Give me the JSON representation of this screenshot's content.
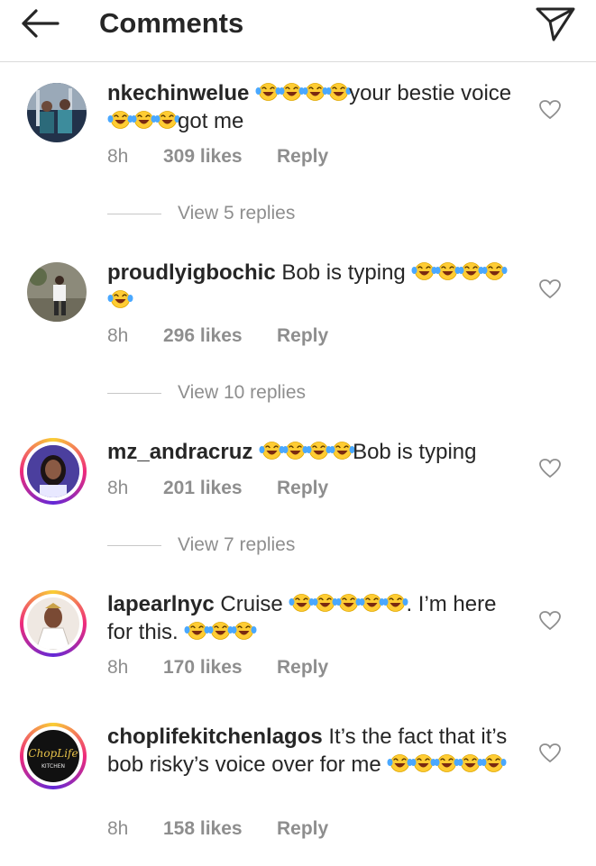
{
  "header": {
    "title": "Comments",
    "back_icon": "arrow-left-icon",
    "send_icon": "direct-send-icon"
  },
  "colors": {
    "text": "#262626",
    "secondary": "#8e8e8e",
    "divider": "#dbdbdb",
    "story_ring": [
      "#f9ce34",
      "#ee2a7b",
      "#6228d7"
    ]
  },
  "comments": [
    {
      "username": "nkechinwelue",
      "segments": [
        "",
        "your bestie voice",
        "got me"
      ],
      "time": "8h",
      "likes": "309 likes",
      "reply": "Reply",
      "view_replies": "View 5 replies"
    },
    {
      "username": "proudlyigbochic",
      "segments": [
        "Bob is typing"
      ],
      "time": "8h",
      "likes": "296 likes",
      "reply": "Reply",
      "view_replies": "View 10 replies"
    },
    {
      "username": "mz_andracruz",
      "segments": [
        "",
        "Bob is typing"
      ],
      "time": "8h",
      "likes": "201 likes",
      "reply": "Reply",
      "view_replies": "View 7 replies"
    },
    {
      "username": "lapearlnyc",
      "segments": [
        "Cruise",
        ". I’m here for this."
      ],
      "time": "8h",
      "likes": "170 likes",
      "reply": "Reply"
    },
    {
      "username": "choplifekitchenlagos",
      "segments": [
        "It’s the fact that it’s bob risky’s voice over for me"
      ],
      "time": "8h",
      "likes": "158 likes",
      "reply": "Reply",
      "avatar_logo_text": "ChopLife KITCHEN"
    }
  ]
}
